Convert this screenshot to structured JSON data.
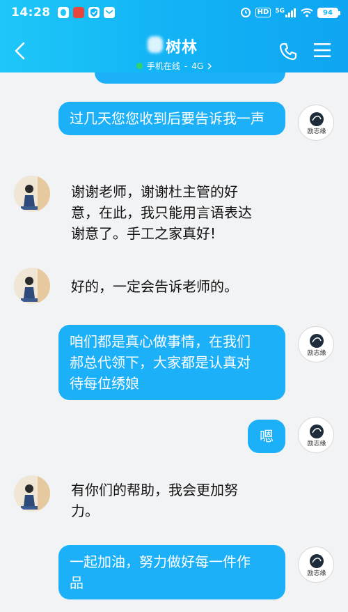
{
  "status_bar": {
    "time": "14:28",
    "hd": "HD",
    "network": "5G",
    "battery": "94"
  },
  "header": {
    "contact_name": "树林",
    "online_status": "手机在线",
    "separator": "-",
    "network_type": "4G",
    "accent_color": "#12b3f5"
  },
  "avatars": {
    "me_logo_text": "励志缘"
  },
  "messages": [
    {
      "side": "out",
      "text": "过几天您您收到后要告诉我一声"
    },
    {
      "side": "in",
      "text_lines": [
        "谢谢老师，谢谢杜主管的好",
        "意，在此，我只能用言语表达",
        "谢意了。手工之家真好!"
      ]
    },
    {
      "side": "in",
      "text": "好的，一定会告诉老师的。"
    },
    {
      "side": "out",
      "text_lines": [
        "咱们都是真心做事情，在我们",
        "郝总代领下，大家都是认真对",
        "待每位绣娘"
      ]
    },
    {
      "side": "out",
      "text": "嗯"
    },
    {
      "side": "in",
      "text_lines": [
        "有你们的帮助，我会更加努",
        "力。"
      ]
    },
    {
      "side": "out",
      "text_lines": [
        "一起加油，努力做好每一件作",
        "品"
      ]
    }
  ]
}
